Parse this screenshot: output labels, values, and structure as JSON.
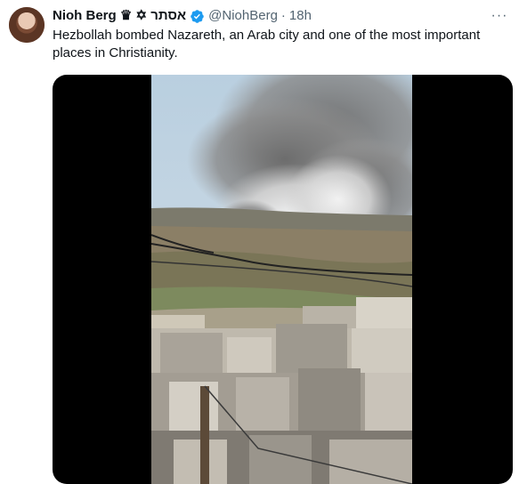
{
  "tweet": {
    "display_name": "Nioh Berg ♛ ✡ אסתר",
    "handle": "@NiohBerg",
    "separator": "·",
    "time": "18h",
    "text": "Hezbollah bombed Nazareth, an Arab city and one of the most important places in Christianity.",
    "more_label": "···"
  },
  "colors": {
    "verified": "#1d9bf0",
    "secondary_text": "#536471",
    "primary_text": "#0f1419"
  },
  "icons": {
    "verified": "verified-badge-icon",
    "more": "more-options-icon"
  }
}
